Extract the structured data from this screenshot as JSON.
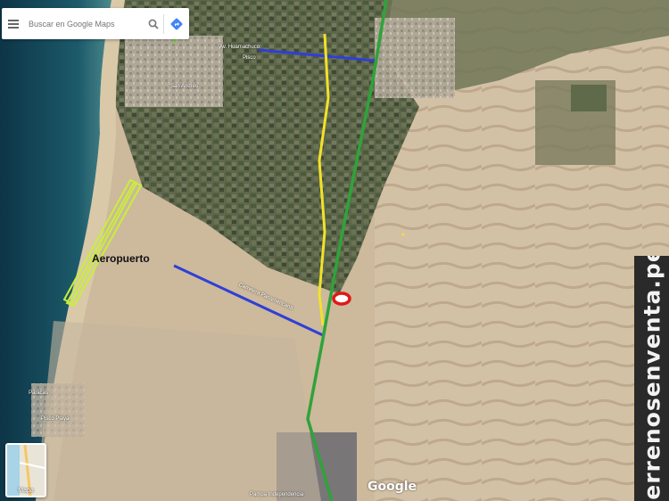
{
  "search": {
    "placeholder": "Buscar en Google Maps"
  },
  "icons": {
    "menu": "hamburger-menu-icon",
    "search": "magnifier-icon",
    "directions": "directions-arrow-icon"
  },
  "colors": {
    "highway_green": "#2fa33a",
    "road_yellow": "#f2e22a",
    "road_blue": "#2f3fd6",
    "airport_outline": "#c8ef3a",
    "marker_red": "#e01818"
  },
  "labels": {
    "airport": "Aeropuerto",
    "town_south": "Pueblo Nuevo",
    "street_1": "Av. Huamachuco",
    "street_2": "Pisco",
    "street_3": "San Andrés",
    "street_4": "Carretera Panamericana",
    "town_bottom": "Pisco Playa",
    "town_bottom2": "Paracas",
    "bottom_center": "Pampa Independencia"
  },
  "maps_toggle": {
    "label": "Mapa"
  },
  "google_logo": "Google",
  "watermark": "terrenosenventa.pe"
}
